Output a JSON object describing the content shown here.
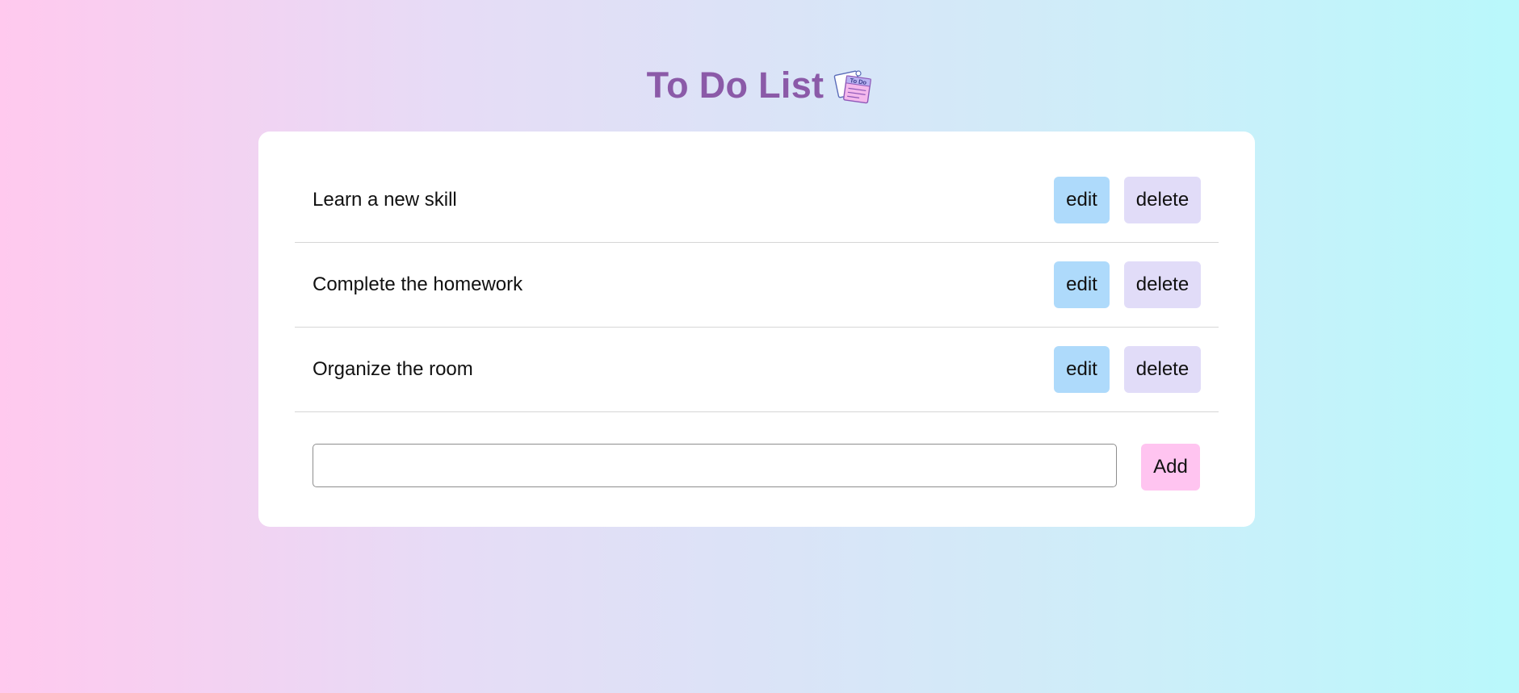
{
  "header": {
    "title": "To Do List",
    "icon": "todo-note-icon",
    "icon_text": "To Do",
    "title_color": "#8b5aa8"
  },
  "tasks": [
    {
      "label": "Learn a new skill",
      "edit_label": "edit",
      "delete_label": "delete"
    },
    {
      "label": "Complete the homework",
      "edit_label": "edit",
      "delete_label": "delete"
    },
    {
      "label": "Organize the room",
      "edit_label": "edit",
      "delete_label": "delete"
    }
  ],
  "add_form": {
    "input_value": "",
    "add_label": "Add"
  },
  "colors": {
    "edit_button": "#aedafb",
    "delete_button": "#e1dcf8",
    "add_button": "#ffc4f0",
    "background_left": "#ffc9ee",
    "background_right": "#b9f8fb"
  }
}
